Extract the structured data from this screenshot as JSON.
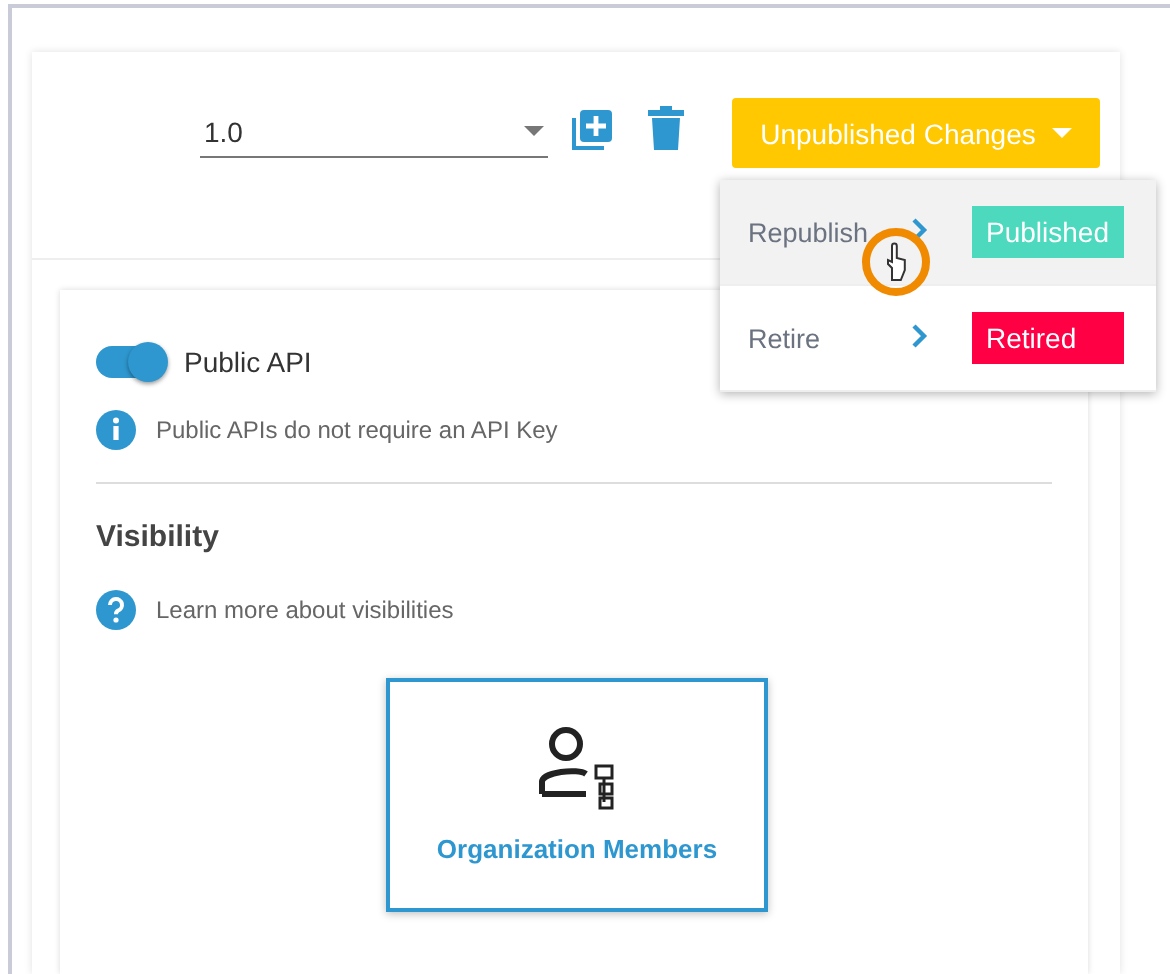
{
  "version_select": {
    "value": "1.0"
  },
  "status_button": {
    "label": "Unpublished Changes"
  },
  "status_menu": [
    {
      "label": "Republish",
      "badge": "Published",
      "color": "#4dd9bd",
      "selected": true
    },
    {
      "label": "Retire",
      "badge": "Retired",
      "color": "#ff0044",
      "selected": false
    }
  ],
  "public_api": {
    "label": "Public API",
    "on": true
  },
  "info_note": "Public APIs do not require an API Key",
  "visibility": {
    "heading": "Visibility",
    "help": "Learn more about visibilities",
    "options": [
      {
        "label": "Organization Members",
        "selected": true
      }
    ]
  }
}
